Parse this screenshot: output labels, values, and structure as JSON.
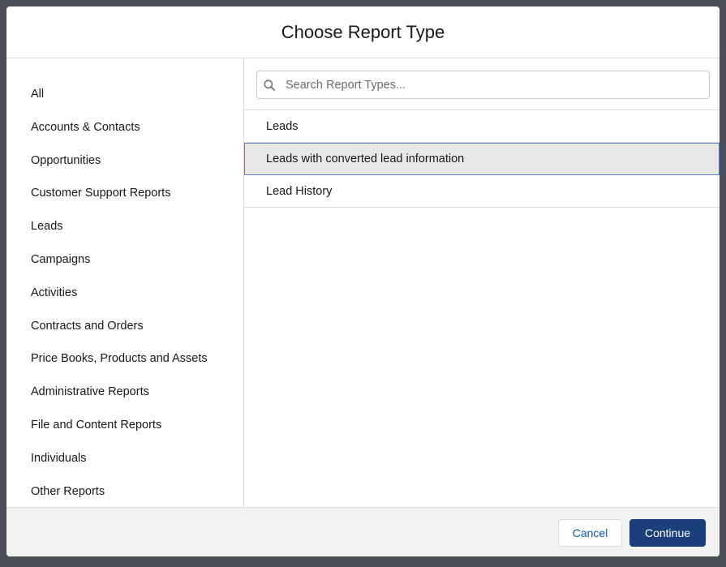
{
  "modal": {
    "title": "Choose Report Type"
  },
  "categories": [
    {
      "label": "All"
    },
    {
      "label": "Accounts & Contacts"
    },
    {
      "label": "Opportunities"
    },
    {
      "label": "Customer Support Reports"
    },
    {
      "label": "Leads"
    },
    {
      "label": "Campaigns"
    },
    {
      "label": "Activities"
    },
    {
      "label": "Contracts and Orders"
    },
    {
      "label": "Price Books, Products and Assets"
    },
    {
      "label": "Administrative Reports"
    },
    {
      "label": "File and Content Reports"
    },
    {
      "label": "Individuals"
    },
    {
      "label": "Other Reports"
    }
  ],
  "search": {
    "placeholder": "Search Report Types...",
    "value": "",
    "icon": "search-icon"
  },
  "report_types": [
    {
      "label": "Leads",
      "selected": false
    },
    {
      "label": "Leads with converted lead information",
      "selected": true
    },
    {
      "label": "Lead History",
      "selected": false
    }
  ],
  "footer": {
    "cancel_label": "Cancel",
    "continue_label": "Continue"
  },
  "colors": {
    "backdrop": "#4a4f56",
    "primary_button": "#1b3f7a",
    "link": "#0b5cab",
    "selected_row": "#e9e8e6",
    "selected_border": "#5a7fb8"
  }
}
